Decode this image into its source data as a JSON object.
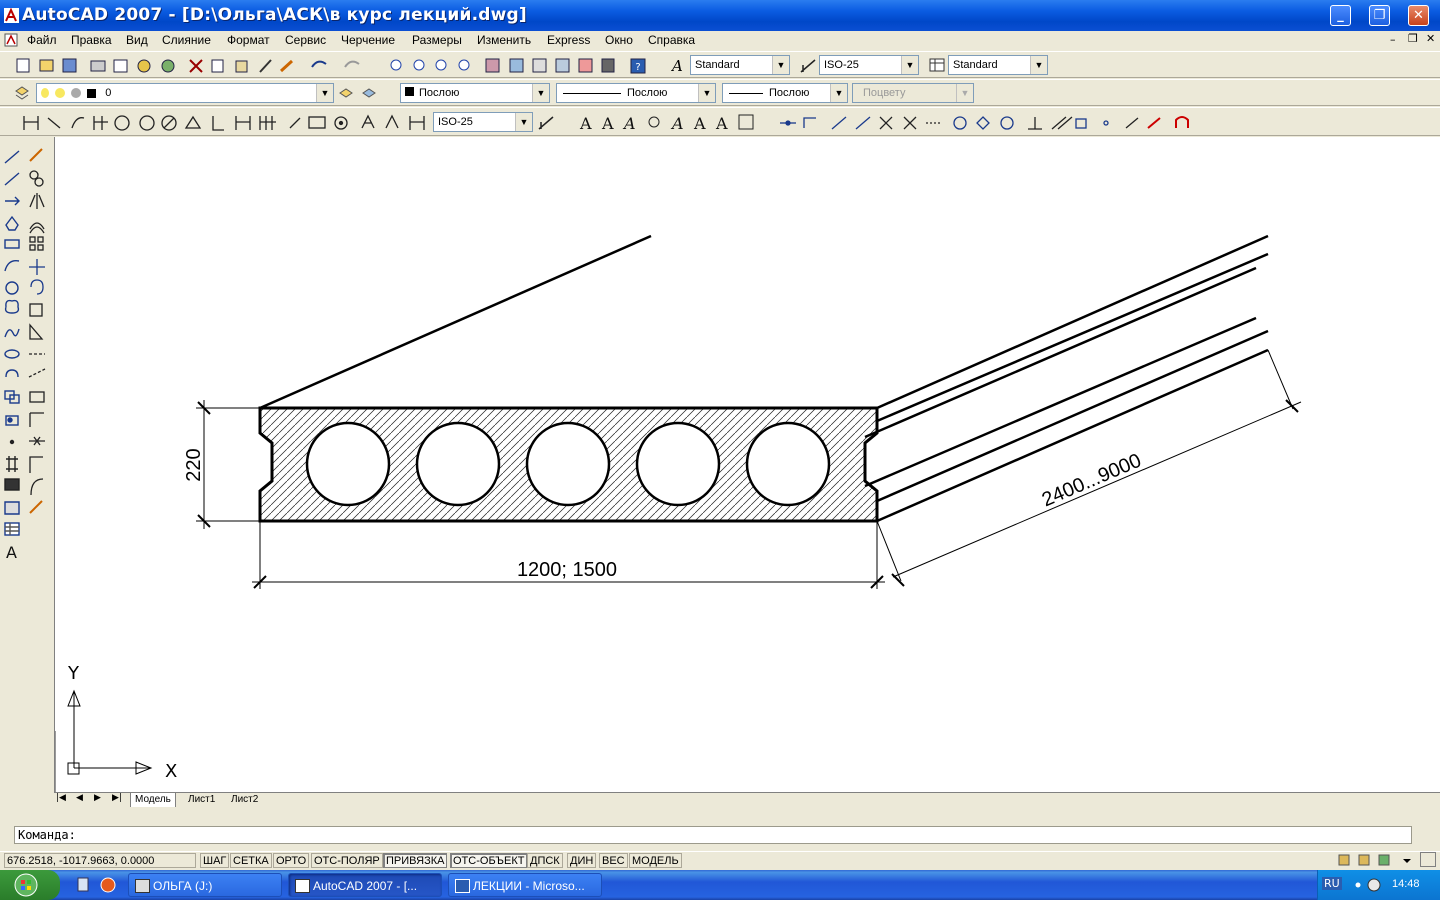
{
  "titlebar": {
    "title": "AutoCAD 2007 - [D:\\Ольга\\АСК\\в курс лекций.dwg]",
    "buttons": [
      "minimize",
      "maximize",
      "close"
    ]
  },
  "menubar": {
    "items": [
      "Файл",
      "Правка",
      "Вид",
      "Слияние",
      "Формат",
      "Сервис",
      "Черчение",
      "Размеры",
      "Изменить",
      "Express",
      "Окно",
      "Справка"
    ]
  },
  "toolbars": {
    "text_style": "Standard",
    "dim_style": "ISO-25",
    "table_style": "Standard",
    "layer": "0",
    "color": "Послою",
    "linetype": "Послою",
    "lineweight": "Послою",
    "plot_style": "Поцвету",
    "dim_style2": "ISO-25"
  },
  "drawing": {
    "dim_height": "220",
    "dim_width": "1200; 1500",
    "dim_length": "2400...9000",
    "ucs_x": "X",
    "ucs_y": "Y"
  },
  "tabs": [
    "Модель",
    "Лист1",
    "Лист2"
  ],
  "command": {
    "prompt": "Команда:"
  },
  "status": {
    "coords": "676.2518, -1017.9663, 0.0000",
    "toggles": [
      "ШАГ",
      "СЕТКА",
      "ОРТО",
      "ОТС-ПОЛЯР",
      "ПРИВЯЗКА",
      "ОТС-ОБЪЕКТ",
      "ДПСК",
      "ДИН",
      "ВЕС",
      "МОДЕЛЬ"
    ]
  },
  "taskbar": {
    "tasks": [
      "ОЛЬГА (J:)",
      "AutoCAD 2007 - [...",
      "ЛЕКЦИИ - Microso..."
    ],
    "language": "RU",
    "clock": "14:48"
  },
  "colors": {
    "title": "#0b5ce2",
    "canvas": "#ffffff",
    "chrome": "#ece9d8"
  }
}
